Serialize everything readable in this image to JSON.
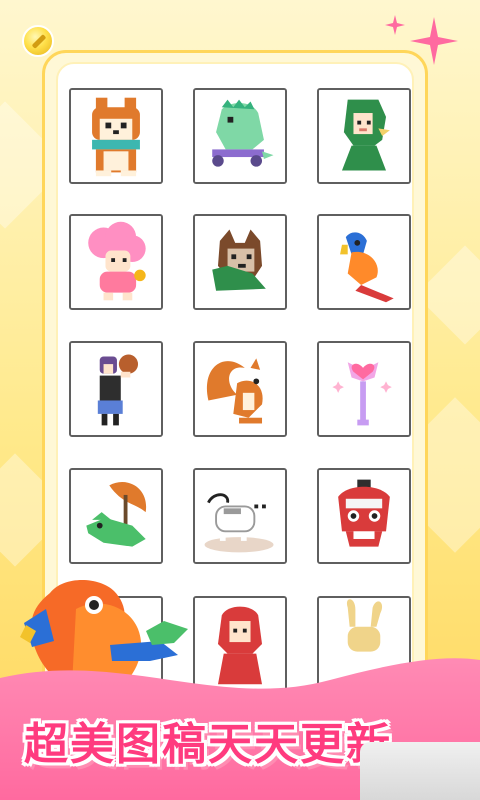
{
  "banner": {
    "slogan": "超美图稿天天更新"
  },
  "colors": {
    "background_top": "#fff7cf",
    "background_bottom": "#ffd65a",
    "panel_border": "#ffd65a",
    "banner_pink": "#ff6a9f",
    "slogan_pink": "#ff3b7f",
    "tile_border": "#5f5f5f"
  },
  "icons": {
    "coin": "coin-icon",
    "sparkle": "star-sparkle-icon"
  },
  "gallery": {
    "tiles": [
      {
        "id": "shiba-dog",
        "name": "shiba-dog-artwork"
      },
      {
        "id": "dino-scooter",
        "name": "dinosaur-on-scooter-artwork"
      },
      {
        "id": "girl-dino-hood",
        "name": "girl-in-dino-hood-artwork"
      },
      {
        "id": "pink-hair-girl",
        "name": "pink-hair-girl-artwork"
      },
      {
        "id": "bulldog-dino",
        "name": "bulldog-in-dino-costume-artwork"
      },
      {
        "id": "parrot",
        "name": "parrot-artwork"
      },
      {
        "id": "basketball-player",
        "name": "basketball-player-artwork"
      },
      {
        "id": "squirrel",
        "name": "squirrel-artwork"
      },
      {
        "id": "magic-wand",
        "name": "magic-wand-artwork"
      },
      {
        "id": "crocodile-umbrella",
        "name": "crocodile-with-umbrella-artwork"
      },
      {
        "id": "cat-walking",
        "name": "walking-cat-artwork"
      },
      {
        "id": "lion-dance",
        "name": "lion-dance-head-artwork"
      },
      {
        "id": "partial-1",
        "name": "partially-hidden-artwork"
      },
      {
        "id": "red-hood-girl",
        "name": "red-riding-hood-artwork"
      },
      {
        "id": "bunny",
        "name": "bunny-artwork"
      }
    ]
  }
}
